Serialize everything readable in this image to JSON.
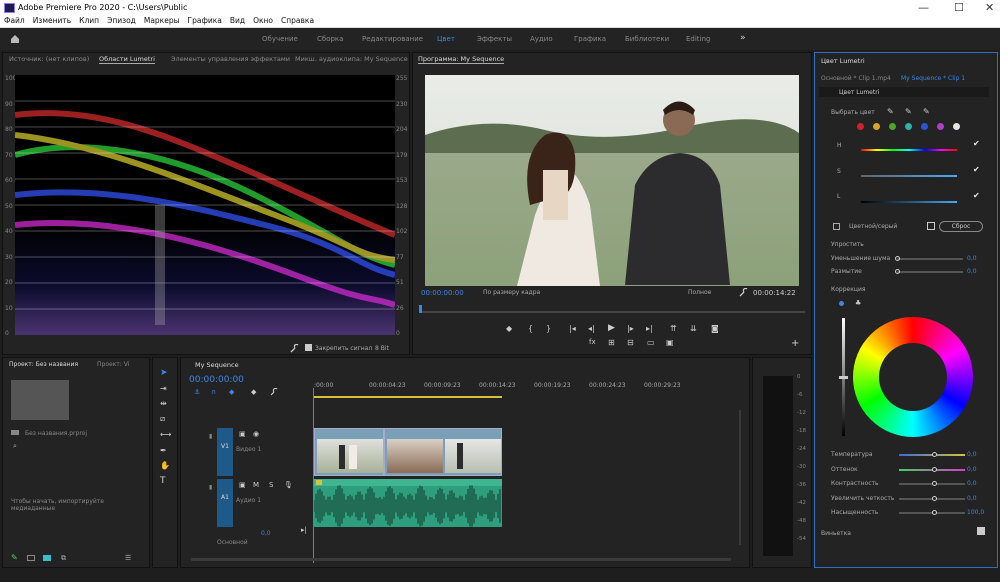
{
  "titlebar": {
    "title": "Adobe Premiere Pro 2020 - C:\\Users\\Public",
    "minimize": "—",
    "maximize": "☐",
    "close": "✕"
  },
  "menu": [
    "Файл",
    "Изменить",
    "Клип",
    "Эпизод",
    "Маркеры",
    "Графика",
    "Вид",
    "Окно",
    "Справка"
  ],
  "workspaces": [
    "Обучение",
    "Сборка",
    "Редактирование",
    "Цвет",
    "Эффекты",
    "Аудио",
    "Графика",
    "Библиотеки",
    "Editing"
  ],
  "more_icon": "»",
  "left_tabs": [
    "Источник: (нет клипов)",
    "Области Lumetri",
    "Элементы управления эффектами",
    "Микш. аудиоклипа: My Sequence"
  ],
  "scope": {
    "y_left": [
      "100",
      "90",
      "80",
      "70",
      "60",
      "50",
      "40",
      "30",
      "20",
      "10",
      "0"
    ],
    "y_right": [
      "255",
      "230",
      "204",
      "179",
      "153",
      "128",
      "102",
      "77",
      "51",
      "26",
      "0"
    ],
    "clamp_label": "Закрепить сигнал",
    "bit_label": "8 Bit"
  },
  "program": {
    "title": "Программа: My Sequence",
    "timecode_left": "00:00:00:00",
    "fit": "По размеру кадра",
    "quality": "Полное",
    "timecode_right": "00:00:14:22"
  },
  "lumetri": {
    "title": "Цвет Lumetri",
    "source_tab": "Основной * Clip 1.mp4",
    "seq_tab": "My Sequence * Clip 1",
    "section": "Цвет Lumetri",
    "select_color": "Выбрать цвет",
    "hsl": [
      "H",
      "S",
      "L"
    ],
    "mode": "Цветной/серый",
    "reset": "Сброс",
    "denoise": "Упростить",
    "denoise_items": [
      {
        "label": "Уменьшение шума",
        "value": "0,0"
      },
      {
        "label": "Размытие",
        "value": "0,0"
      }
    ],
    "correction": "Коррекция",
    "corr_items": [
      {
        "label": "Температура",
        "value": "0,0"
      },
      {
        "label": "Оттенок",
        "value": "0,0"
      },
      {
        "label": "Контрастность",
        "value": "0,0"
      },
      {
        "label": "Увеличить четкость",
        "value": "0,0"
      },
      {
        "label": "Насыщенность",
        "value": "100,0"
      }
    ],
    "vignette": "Виньетка",
    "swatch_colors": [
      "#d2222f",
      "#d9a527",
      "#4fa626",
      "#2bb3a7",
      "#2f55d6",
      "#b03fc8",
      "#e6e6e6"
    ]
  },
  "project": {
    "tab": "Проект: Без названия",
    "tab2": "Проект: Vi",
    "item": "Без названия.prproj",
    "hint": "Чтобы начать, импортируйте медиаданные"
  },
  "timeline": {
    "tab": "My Sequence",
    "timecode": "00:00:00:00",
    "ruler": [
      ":00:00",
      "00:00:04:23",
      "00:00:09:23",
      "00:00:14:23",
      "00:00:19:23",
      "00:00:24:23",
      "00:00:29:23"
    ],
    "v1": "V1",
    "v1_name": "Видео 1",
    "a1": "A1",
    "a1_name": "Аудио 1",
    "master": "Основной",
    "master_val": "0,0"
  },
  "meter": [
    "0",
    "-6",
    "-12",
    "-18",
    "-24",
    "-30",
    "-36",
    "-42",
    "-48",
    "-54"
  ]
}
